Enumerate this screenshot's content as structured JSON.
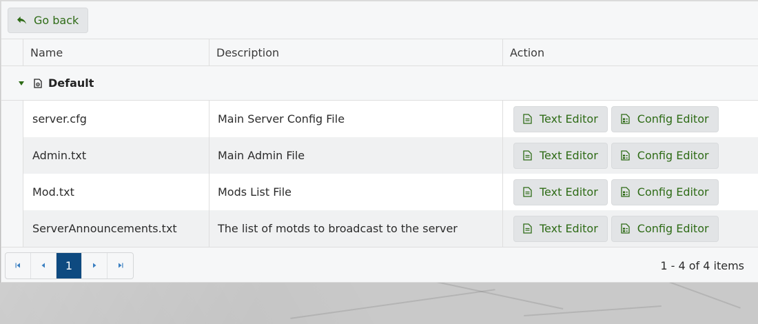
{
  "toolbar": {
    "back_label": "Go back"
  },
  "columns": {
    "name": "Name",
    "description": "Description",
    "action": "Action"
  },
  "group": {
    "title": "Default"
  },
  "rows": [
    {
      "name": "server.cfg",
      "description": "Main Server Config File",
      "text_editor": "Text Editor",
      "config_editor": "Config Editor"
    },
    {
      "name": "Admin.txt",
      "description": "Main Admin File",
      "text_editor": "Text Editor",
      "config_editor": "Config Editor"
    },
    {
      "name": "Mod.txt",
      "description": "Mods List File",
      "text_editor": "Text Editor",
      "config_editor": "Config Editor"
    },
    {
      "name": "ServerAnnouncements.txt",
      "description": "The list of motds to broadcast to the server",
      "text_editor": "Text Editor",
      "config_editor": "Config Editor"
    }
  ],
  "pager": {
    "current_page": "1",
    "info": "1 - 4 of 4 items"
  },
  "colors": {
    "accent_green": "#2e6b16",
    "pager_active": "#0e4a80"
  }
}
